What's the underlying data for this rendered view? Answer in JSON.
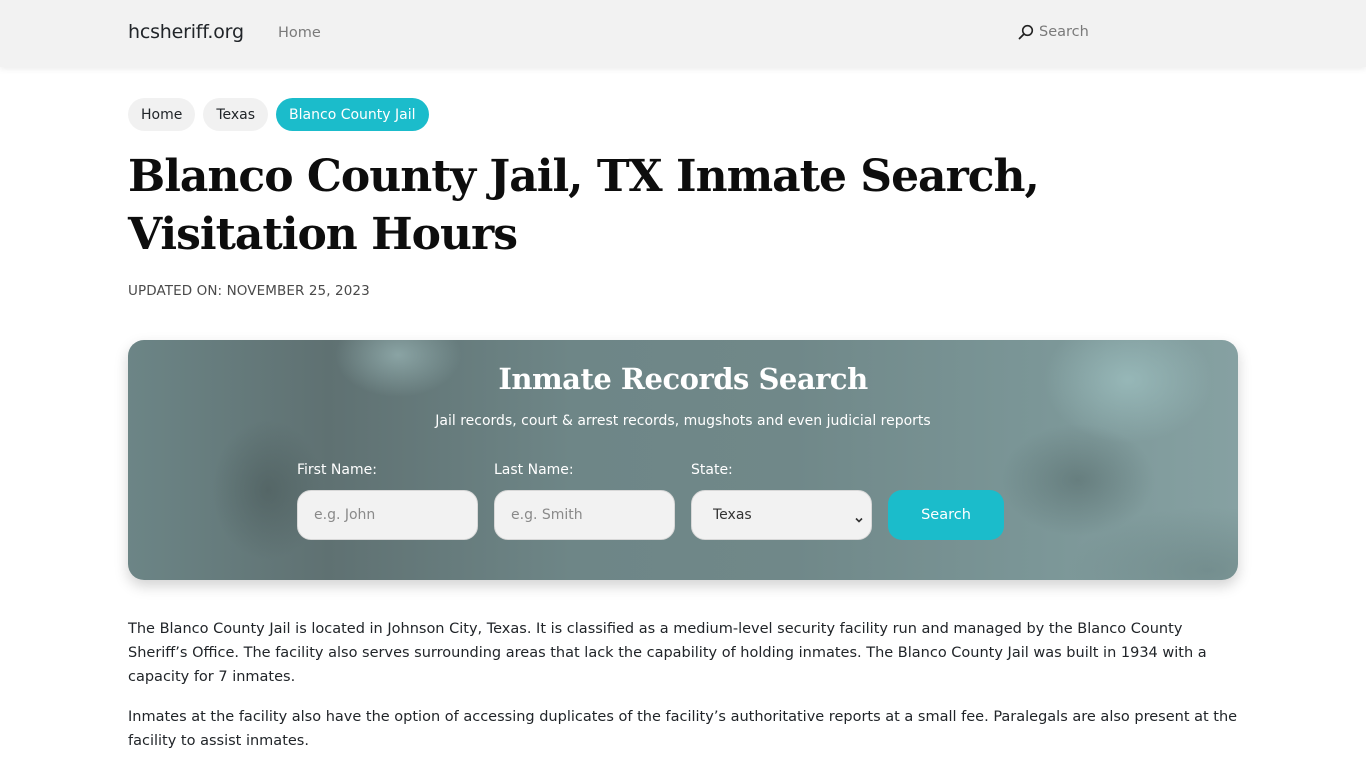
{
  "navbar": {
    "brand": "hcsheriff.org",
    "home_link": "Home",
    "search_label": "Search",
    "search_icon": "search-icon"
  },
  "breadcrumb": [
    {
      "label": "Home",
      "active": false
    },
    {
      "label": "Texas",
      "active": false
    },
    {
      "label": "Blanco County Jail",
      "active": true
    }
  ],
  "page": {
    "title": "Blanco County Jail, TX Inmate Search, Visitation Hours",
    "updated": "UPDATED ON: NOVEMBER 25, 2023"
  },
  "search_panel": {
    "title": "Inmate Records Search",
    "subtitle": "Jail records, court & arrest records, mugshots and even judicial reports",
    "first_name": {
      "label": "First Name:",
      "placeholder": "e.g. John",
      "value": ""
    },
    "last_name": {
      "label": "Last Name:",
      "placeholder": "e.g. Smith",
      "value": ""
    },
    "state": {
      "label": "State:",
      "selected": "Texas"
    },
    "button_label": "Search"
  },
  "content": {
    "paragraphs": [
      "The Blanco County Jail is located in Johnson City, Texas. It is classified as a medium-level security facility run and managed by the Blanco County Sheriff’s Office. The facility also serves surrounding areas that lack the capability of holding inmates. The Blanco County Jail was built in 1934 with a capacity for 7 inmates.",
      "Inmates at the facility also have the option of accessing duplicates of the facility’s authoritative reports at a small fee. Paralegals are also present at the facility to assist inmates."
    ]
  },
  "colors": {
    "accent": "#1bbccb",
    "navbar_bg": "#f2f2f2",
    "hero_bg": "#6e8687"
  }
}
